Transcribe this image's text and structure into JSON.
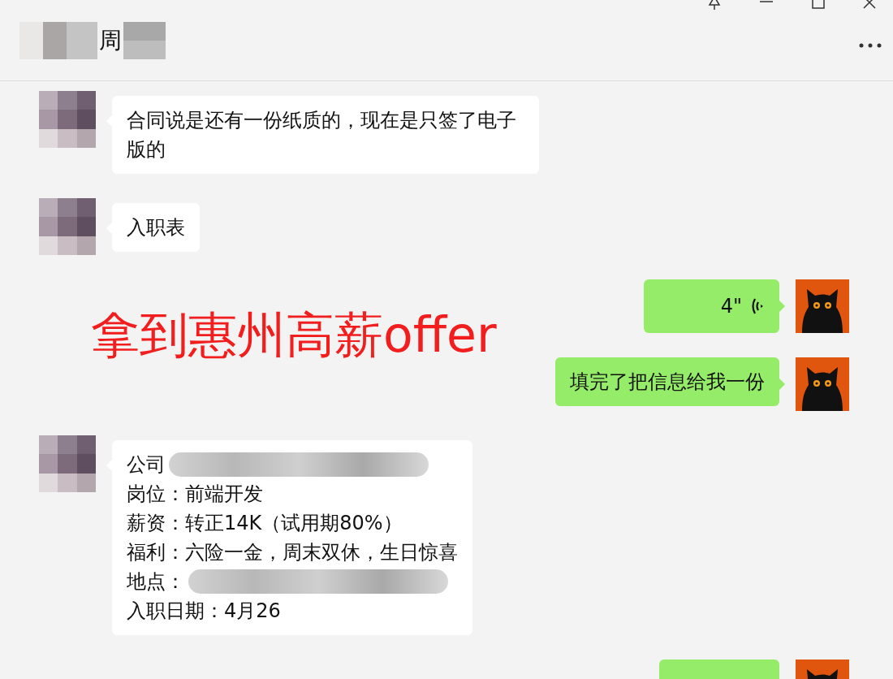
{
  "window": {
    "title": "周"
  },
  "messages": [
    {
      "outgoing": false,
      "kind": "text",
      "lines": [
        {
          "text": "合同说是还有一份纸质的，现在是只签了电子版的"
        }
      ]
    },
    {
      "outgoing": false,
      "kind": "text",
      "lines": [
        {
          "text": "入职表"
        }
      ]
    },
    {
      "outgoing": true,
      "kind": "voice",
      "duration": "4\""
    },
    {
      "outgoing": true,
      "kind": "text",
      "lines": [
        {
          "text": "填完了把信息给我一份"
        }
      ]
    },
    {
      "outgoing": false,
      "kind": "text",
      "lines": [
        {
          "text": "公司",
          "blurred": true
        },
        {
          "text": "岗位：前端开发"
        },
        {
          "text": "薪资：转正14K（试用期80%）"
        },
        {
          "text": "福利：六险一金，周末双休，生日惊喜"
        },
        {
          "text": "地点：",
          "blurred": true
        },
        {
          "text": "入职日期：4月26"
        }
      ]
    },
    {
      "outgoing": true,
      "kind": "partial"
    }
  ],
  "overlay": {
    "text": "拿到惠州高薪offer"
  }
}
